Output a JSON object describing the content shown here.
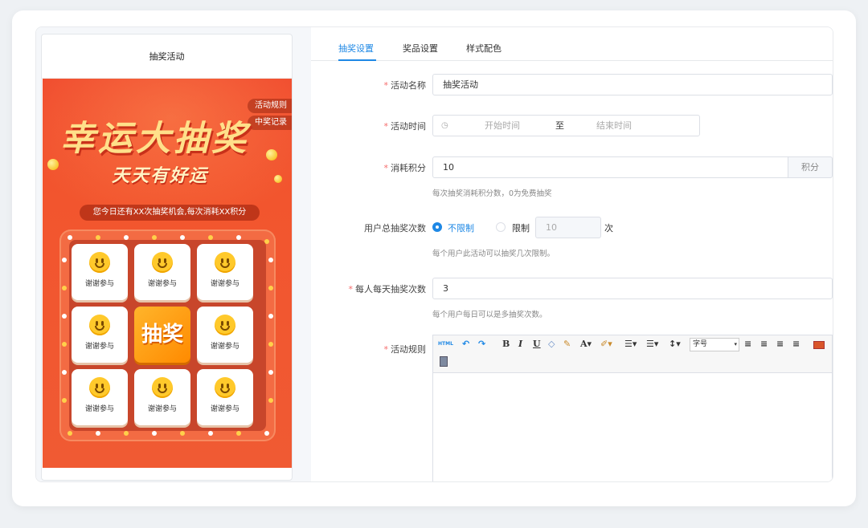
{
  "preview": {
    "title": "抽奖活动",
    "rules_tag": "活动规则",
    "records_tag": "中奖记录",
    "headline": "幸运大抽奖",
    "subheadline": "天天有好运",
    "notice": "您今日还有XX次抽奖机会,每次消耗XX积分",
    "cells": [
      "谢谢参与",
      "谢谢参与",
      "谢谢参与",
      "谢谢参与",
      "谢谢参与",
      "谢谢参与",
      "谢谢参与",
      "谢谢参与"
    ],
    "draw_button": "抽奖"
  },
  "tabs": [
    "抽奖设置",
    "奖品设置",
    "样式配色"
  ],
  "form": {
    "name": {
      "label": "活动名称",
      "value": "抽奖活动"
    },
    "time": {
      "label": "活动时间",
      "start_placeholder": "开始时间",
      "separator": "至",
      "end_placeholder": "结束时间"
    },
    "points": {
      "label": "消耗积分",
      "value": "10",
      "suffix": "积分",
      "hint": "每次抽奖消耗积分数，0为免费抽奖"
    },
    "total_limit": {
      "label": "用户总抽奖次数",
      "option_unlimited": "不限制",
      "option_limit": "限制",
      "limit_value": "10",
      "unit": "次",
      "hint": "每个用户此活动可以抽奖几次限制。"
    },
    "daily_limit": {
      "label": "每人每天抽奖次数",
      "value": "3",
      "hint": "每个用户每日可以是多抽奖次数。"
    },
    "rules": {
      "label": "活动规则",
      "font_size_select": "字号"
    }
  },
  "colors": {
    "accent": "#1e88e5",
    "required": "#f56c6c",
    "poster": "#f04a2d"
  }
}
